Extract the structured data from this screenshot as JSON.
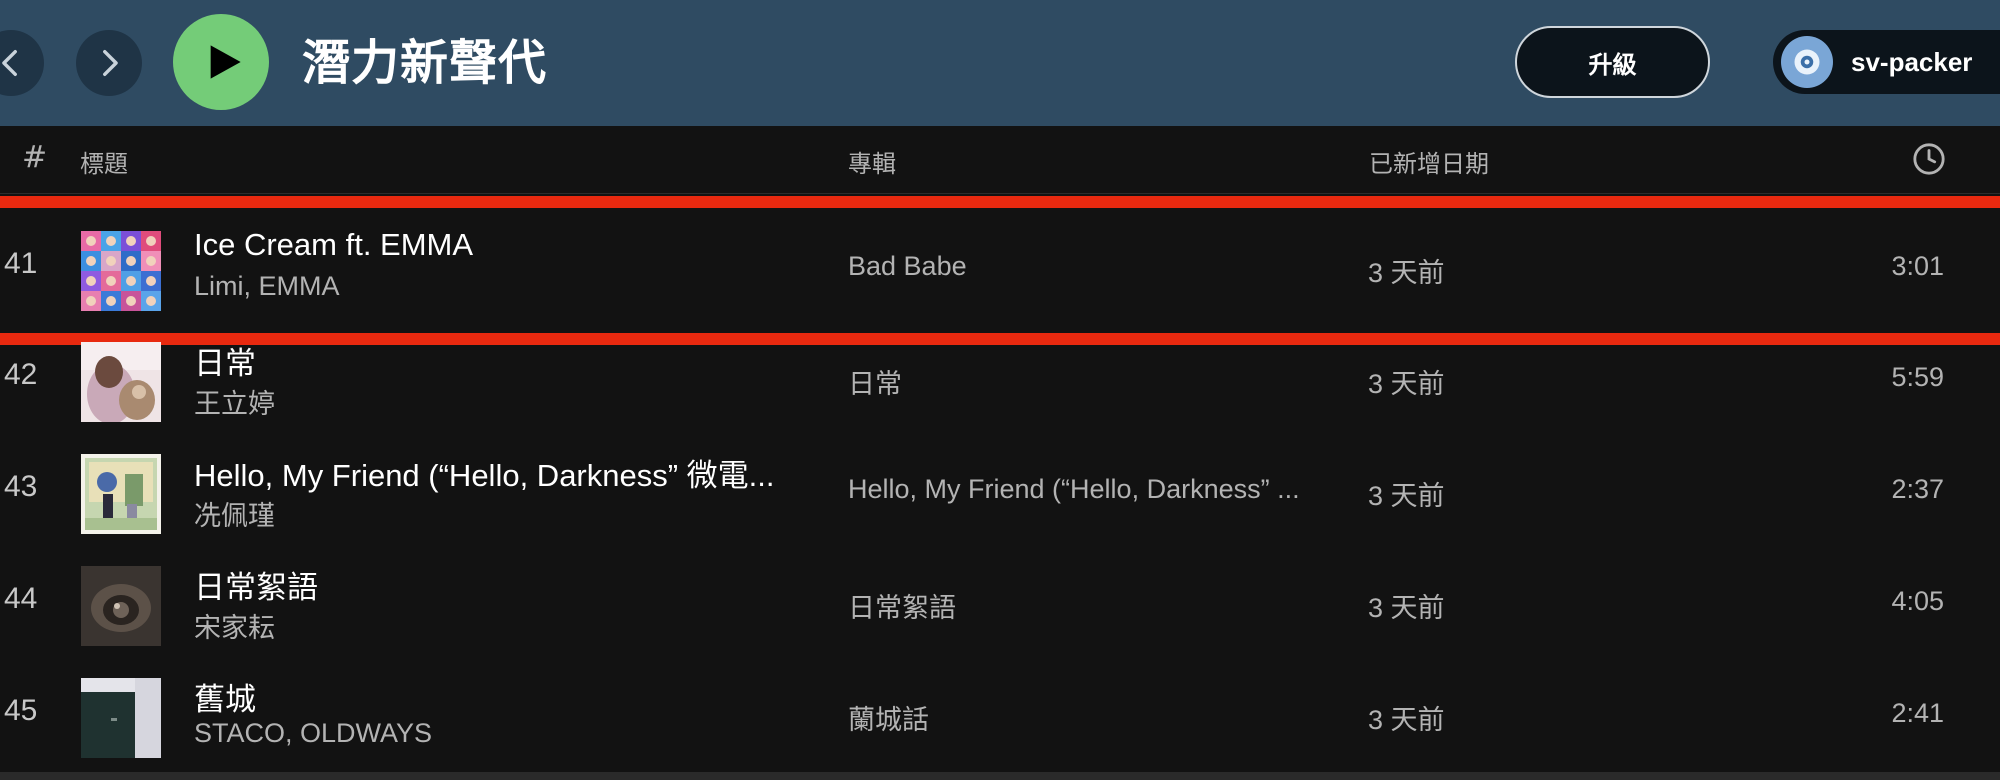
{
  "header": {
    "title": "潛力新聲代",
    "upgrade_label": "升級",
    "user_name": "sv-packer",
    "background": "#2f4b62",
    "play_color": "#74cc78"
  },
  "columns": {
    "number": "#",
    "title": "標題",
    "album": "專輯",
    "date_added": "已新增日期",
    "duration_icon": "clock-icon"
  },
  "highlight_color": "#e8290f",
  "tracks": [
    {
      "number": "41",
      "title": "Ice Cream ft. EMMA",
      "artist": "Limi, EMMA",
      "album": "Bad Babe",
      "date_added": "3 天前",
      "duration": "3:01"
    },
    {
      "number": "42",
      "title": "日常",
      "artist": "王立婷",
      "album": "日常",
      "date_added": "3 天前",
      "duration": "5:59"
    },
    {
      "number": "43",
      "title": "Hello, My Friend (“Hello, Darkness” 微電...",
      "artist": "冼佩瑾",
      "album": "Hello, My Friend (“Hello, Darkness” ...",
      "date_added": "3 天前",
      "duration": "2:37"
    },
    {
      "number": "44",
      "title": "日常絮語",
      "artist": "宋家耘",
      "album": "日常絮語",
      "date_added": "3 天前",
      "duration": "4:05"
    },
    {
      "number": "45",
      "title": "舊城",
      "artist": "STACO, OLDWAYS",
      "album": "蘭城話",
      "date_added": "3 天前",
      "duration": "2:41"
    }
  ]
}
